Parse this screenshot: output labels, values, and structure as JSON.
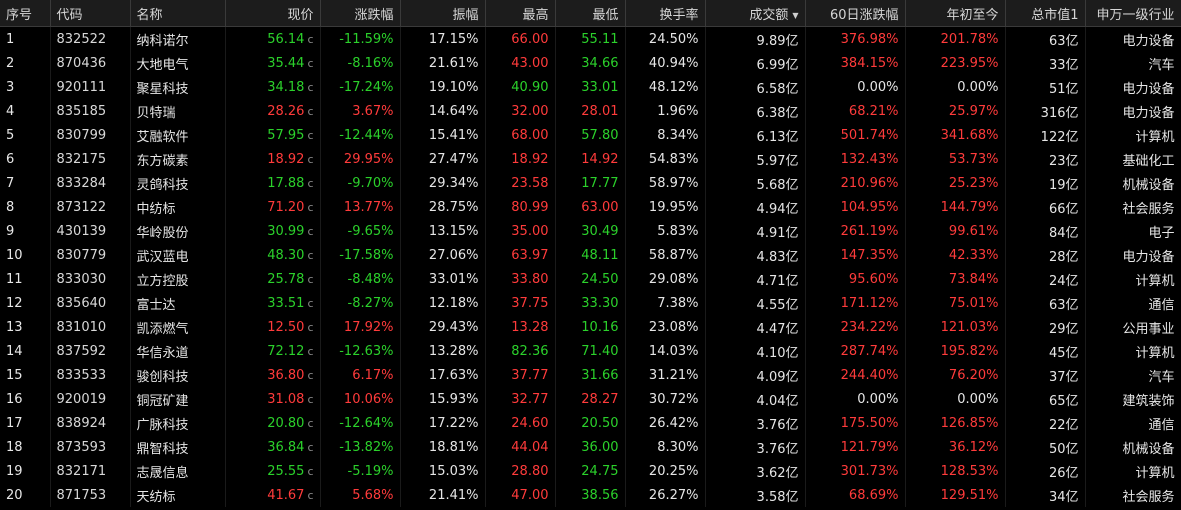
{
  "headers": [
    "序号",
    "代码",
    "名称",
    "现价",
    "涨跌幅",
    "振幅",
    "最高",
    "最低",
    "换手率",
    "成交额",
    "60日涨跌幅",
    "年初至今",
    "总市值1",
    "申万一级行业"
  ],
  "price_suffix": "c",
  "colors": {
    "up": "#ff3b3b",
    "down": "#2bd12b",
    "flat": "#e6e6e6"
  },
  "rows": [
    {
      "no": "1",
      "code": "832522",
      "name": "纳科诺尔",
      "price": "56.14",
      "price_dir": "down",
      "chg": "-11.59%",
      "chg_dir": "down",
      "amp": "17.15%",
      "high": "66.00",
      "high_dir": "up",
      "low": "55.11",
      "low_dir": "down",
      "turnover": "24.50%",
      "amount": "9.89亿",
      "d60": "376.98%",
      "d60_dir": "up",
      "ytd": "201.78%",
      "ytd_dir": "up",
      "mcap": "63亿",
      "industry": "电力设备"
    },
    {
      "no": "2",
      "code": "870436",
      "name": "大地电气",
      "price": "35.44",
      "price_dir": "down",
      "chg": "-8.16%",
      "chg_dir": "down",
      "amp": "21.61%",
      "high": "43.00",
      "high_dir": "up",
      "low": "34.66",
      "low_dir": "down",
      "turnover": "40.94%",
      "amount": "6.99亿",
      "d60": "384.15%",
      "d60_dir": "up",
      "ytd": "223.95%",
      "ytd_dir": "up",
      "mcap": "33亿",
      "industry": "汽车"
    },
    {
      "no": "3",
      "code": "920111",
      "name": "聚星科技",
      "price": "34.18",
      "price_dir": "down",
      "chg": "-17.24%",
      "chg_dir": "down",
      "amp": "19.10%",
      "high": "40.90",
      "high_dir": "down",
      "low": "33.01",
      "low_dir": "down",
      "turnover": "48.12%",
      "amount": "6.58亿",
      "d60": "0.00%",
      "d60_dir": "flat",
      "ytd": "0.00%",
      "ytd_dir": "flat",
      "mcap": "51亿",
      "industry": "电力设备"
    },
    {
      "no": "4",
      "code": "835185",
      "name": "贝特瑞",
      "price": "28.26",
      "price_dir": "up",
      "chg": "3.67%",
      "chg_dir": "up",
      "amp": "14.64%",
      "high": "32.00",
      "high_dir": "up",
      "low": "28.01",
      "low_dir": "up",
      "turnover": "1.96%",
      "amount": "6.38亿",
      "d60": "68.21%",
      "d60_dir": "up",
      "ytd": "25.97%",
      "ytd_dir": "up",
      "mcap": "316亿",
      "industry": "电力设备"
    },
    {
      "no": "5",
      "code": "830799",
      "name": "艾融软件",
      "price": "57.95",
      "price_dir": "down",
      "chg": "-12.44%",
      "chg_dir": "down",
      "amp": "15.41%",
      "high": "68.00",
      "high_dir": "up",
      "low": "57.80",
      "low_dir": "down",
      "turnover": "8.34%",
      "amount": "6.13亿",
      "d60": "501.74%",
      "d60_dir": "up",
      "ytd": "341.68%",
      "ytd_dir": "up",
      "mcap": "122亿",
      "industry": "计算机"
    },
    {
      "no": "6",
      "code": "832175",
      "name": "东方碳素",
      "price": "18.92",
      "price_dir": "up",
      "chg": "29.95%",
      "chg_dir": "up",
      "amp": "27.47%",
      "high": "18.92",
      "high_dir": "up",
      "low": "14.92",
      "low_dir": "up",
      "turnover": "54.83%",
      "amount": "5.97亿",
      "d60": "132.43%",
      "d60_dir": "up",
      "ytd": "53.73%",
      "ytd_dir": "up",
      "mcap": "23亿",
      "industry": "基础化工"
    },
    {
      "no": "7",
      "code": "833284",
      "name": "灵鸽科技",
      "price": "17.88",
      "price_dir": "down",
      "chg": "-9.70%",
      "chg_dir": "down",
      "amp": "29.34%",
      "high": "23.58",
      "high_dir": "up",
      "low": "17.77",
      "low_dir": "down",
      "turnover": "58.97%",
      "amount": "5.68亿",
      "d60": "210.96%",
      "d60_dir": "up",
      "ytd": "25.23%",
      "ytd_dir": "up",
      "mcap": "19亿",
      "industry": "机械设备"
    },
    {
      "no": "8",
      "code": "873122",
      "name": "中纺标",
      "price": "71.20",
      "price_dir": "up",
      "chg": "13.77%",
      "chg_dir": "up",
      "amp": "28.75%",
      "high": "80.99",
      "high_dir": "up",
      "low": "63.00",
      "low_dir": "up",
      "turnover": "19.95%",
      "amount": "4.94亿",
      "d60": "104.95%",
      "d60_dir": "up",
      "ytd": "144.79%",
      "ytd_dir": "up",
      "mcap": "66亿",
      "industry": "社会服务"
    },
    {
      "no": "9",
      "code": "430139",
      "name": "华岭股份",
      "price": "30.99",
      "price_dir": "down",
      "chg": "-9.65%",
      "chg_dir": "down",
      "amp": "13.15%",
      "high": "35.00",
      "high_dir": "up",
      "low": "30.49",
      "low_dir": "down",
      "turnover": "5.83%",
      "amount": "4.91亿",
      "d60": "261.19%",
      "d60_dir": "up",
      "ytd": "99.61%",
      "ytd_dir": "up",
      "mcap": "84亿",
      "industry": "电子"
    },
    {
      "no": "10",
      "code": "830779",
      "name": "武汉蓝电",
      "price": "48.30",
      "price_dir": "down",
      "chg": "-17.58%",
      "chg_dir": "down",
      "amp": "27.06%",
      "high": "63.97",
      "high_dir": "up",
      "low": "48.11",
      "low_dir": "down",
      "turnover": "58.87%",
      "amount": "4.83亿",
      "d60": "147.35%",
      "d60_dir": "up",
      "ytd": "42.33%",
      "ytd_dir": "up",
      "mcap": "28亿",
      "industry": "电力设备"
    },
    {
      "no": "11",
      "code": "833030",
      "name": "立方控股",
      "price": "25.78",
      "price_dir": "down",
      "chg": "-8.48%",
      "chg_dir": "down",
      "amp": "33.01%",
      "high": "33.80",
      "high_dir": "up",
      "low": "24.50",
      "low_dir": "down",
      "turnover": "29.08%",
      "amount": "4.71亿",
      "d60": "95.60%",
      "d60_dir": "up",
      "ytd": "73.84%",
      "ytd_dir": "up",
      "mcap": "24亿",
      "industry": "计算机"
    },
    {
      "no": "12",
      "code": "835640",
      "name": "富士达",
      "price": "33.51",
      "price_dir": "down",
      "chg": "-8.27%",
      "chg_dir": "down",
      "amp": "12.18%",
      "high": "37.75",
      "high_dir": "up",
      "low": "33.30",
      "low_dir": "down",
      "turnover": "7.38%",
      "amount": "4.55亿",
      "d60": "171.12%",
      "d60_dir": "up",
      "ytd": "75.01%",
      "ytd_dir": "up",
      "mcap": "63亿",
      "industry": "通信"
    },
    {
      "no": "13",
      "code": "831010",
      "name": "凯添燃气",
      "price": "12.50",
      "price_dir": "up",
      "chg": "17.92%",
      "chg_dir": "up",
      "amp": "29.43%",
      "high": "13.28",
      "high_dir": "up",
      "low": "10.16",
      "low_dir": "down",
      "turnover": "23.08%",
      "amount": "4.47亿",
      "d60": "234.22%",
      "d60_dir": "up",
      "ytd": "121.03%",
      "ytd_dir": "up",
      "mcap": "29亿",
      "industry": "公用事业"
    },
    {
      "no": "14",
      "code": "837592",
      "name": "华信永道",
      "price": "72.12",
      "price_dir": "down",
      "chg": "-12.63%",
      "chg_dir": "down",
      "amp": "13.28%",
      "high": "82.36",
      "high_dir": "down",
      "low": "71.40",
      "low_dir": "down",
      "turnover": "14.03%",
      "amount": "4.10亿",
      "d60": "287.74%",
      "d60_dir": "up",
      "ytd": "195.82%",
      "ytd_dir": "up",
      "mcap": "45亿",
      "industry": "计算机"
    },
    {
      "no": "15",
      "code": "833533",
      "name": "骏创科技",
      "price": "36.80",
      "price_dir": "up",
      "chg": "6.17%",
      "chg_dir": "up",
      "amp": "17.63%",
      "high": "37.77",
      "high_dir": "up",
      "low": "31.66",
      "low_dir": "down",
      "turnover": "31.21%",
      "amount": "4.09亿",
      "d60": "244.40%",
      "d60_dir": "up",
      "ytd": "76.20%",
      "ytd_dir": "up",
      "mcap": "37亿",
      "industry": "汽车"
    },
    {
      "no": "16",
      "code": "920019",
      "name": "铜冠矿建",
      "price": "31.08",
      "price_dir": "up",
      "chg": "10.06%",
      "chg_dir": "up",
      "amp": "15.93%",
      "high": "32.77",
      "high_dir": "up",
      "low": "28.27",
      "low_dir": "up",
      "turnover": "30.72%",
      "amount": "4.04亿",
      "d60": "0.00%",
      "d60_dir": "flat",
      "ytd": "0.00%",
      "ytd_dir": "flat",
      "mcap": "65亿",
      "industry": "建筑装饰"
    },
    {
      "no": "17",
      "code": "838924",
      "name": "广脉科技",
      "price": "20.80",
      "price_dir": "down",
      "chg": "-12.64%",
      "chg_dir": "down",
      "amp": "17.22%",
      "high": "24.60",
      "high_dir": "up",
      "low": "20.50",
      "low_dir": "down",
      "turnover": "26.42%",
      "amount": "3.76亿",
      "d60": "175.50%",
      "d60_dir": "up",
      "ytd": "126.85%",
      "ytd_dir": "up",
      "mcap": "22亿",
      "industry": "通信"
    },
    {
      "no": "18",
      "code": "873593",
      "name": "鼎智科技",
      "price": "36.84",
      "price_dir": "down",
      "chg": "-13.82%",
      "chg_dir": "down",
      "amp": "18.81%",
      "high": "44.04",
      "high_dir": "up",
      "low": "36.00",
      "low_dir": "down",
      "turnover": "8.30%",
      "amount": "3.76亿",
      "d60": "121.79%",
      "d60_dir": "up",
      "ytd": "36.12%",
      "ytd_dir": "up",
      "mcap": "50亿",
      "industry": "机械设备"
    },
    {
      "no": "19",
      "code": "832171",
      "name": "志晟信息",
      "price": "25.55",
      "price_dir": "down",
      "chg": "-5.19%",
      "chg_dir": "down",
      "amp": "15.03%",
      "high": "28.80",
      "high_dir": "up",
      "low": "24.75",
      "low_dir": "down",
      "turnover": "20.25%",
      "amount": "3.62亿",
      "d60": "301.73%",
      "d60_dir": "up",
      "ytd": "128.53%",
      "ytd_dir": "up",
      "mcap": "26亿",
      "industry": "计算机"
    },
    {
      "no": "20",
      "code": "871753",
      "name": "天纺标",
      "price": "41.67",
      "price_dir": "up",
      "chg": "5.68%",
      "chg_dir": "up",
      "amp": "21.41%",
      "high": "47.00",
      "high_dir": "up",
      "low": "38.56",
      "low_dir": "down",
      "turnover": "26.27%",
      "amount": "3.58亿",
      "d60": "68.69%",
      "d60_dir": "up",
      "ytd": "129.51%",
      "ytd_dir": "up",
      "mcap": "34亿",
      "industry": "社会服务"
    }
  ]
}
